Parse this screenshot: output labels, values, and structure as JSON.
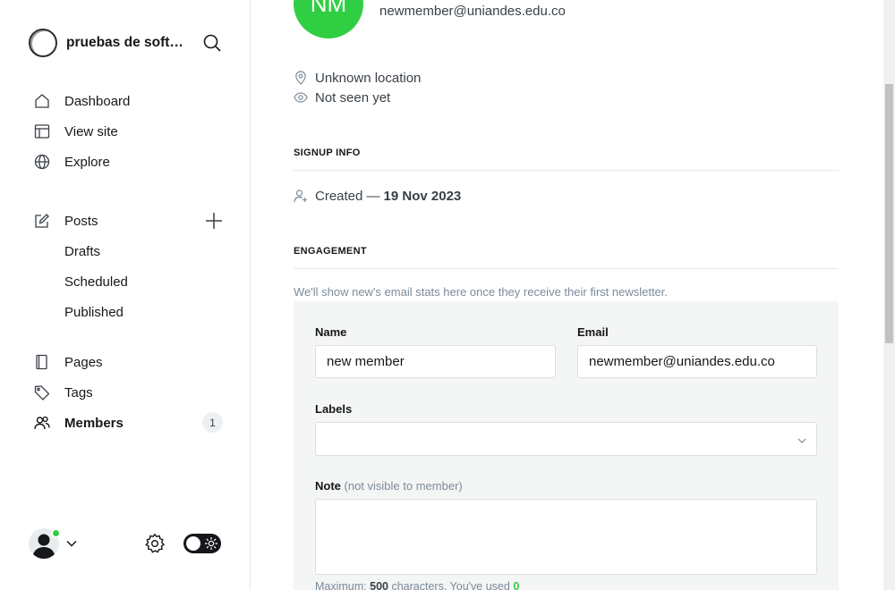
{
  "site": {
    "name": "pruebas de software"
  },
  "nav": {
    "primary": [
      {
        "label": "Dashboard",
        "icon": "house-icon"
      },
      {
        "label": "View site",
        "icon": "layout-icon"
      },
      {
        "label": "Explore",
        "icon": "globe-icon"
      }
    ],
    "posts": {
      "label": "Posts",
      "icon": "pencil-icon",
      "subitems": [
        "Drafts",
        "Scheduled",
        "Published"
      ]
    },
    "secondary": [
      {
        "label": "Pages",
        "icon": "page-icon"
      },
      {
        "label": "Tags",
        "icon": "tag-icon"
      },
      {
        "label": "Members",
        "icon": "members-icon",
        "count": "1",
        "active": true
      }
    ]
  },
  "member": {
    "initials": "NM",
    "email": "newmember@uniandes.edu.co",
    "location": "Unknown location",
    "last_seen": "Not seen yet"
  },
  "signup": {
    "title": "SIGNUP INFO",
    "created_label": "Created —",
    "created_date": "19 Nov 2023"
  },
  "engagement": {
    "title": "ENGAGEMENT",
    "note": "We'll show new's email stats here once they receive their first newsletter."
  },
  "form": {
    "name_label": "Name",
    "name_value": "new member",
    "email_label": "Email",
    "email_value": "newmember@uniandes.edu.co",
    "labels_label": "Labels",
    "note_label": "Note",
    "note_hint": "(not visible to member)",
    "char_prefix": "Maximum:",
    "char_max": "500",
    "char_mid": "characters. You've used",
    "char_used": "0"
  },
  "colors": {
    "accent": "#30cf43",
    "text": "#15171a",
    "muted": "#7c8b9a",
    "panel": "#f4f5f5"
  }
}
